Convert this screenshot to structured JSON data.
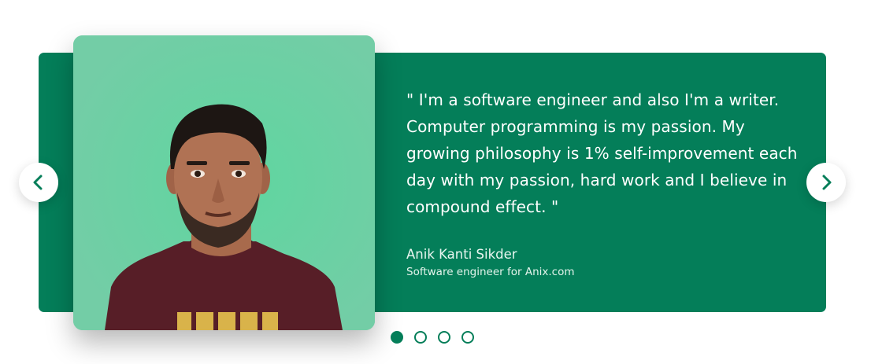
{
  "testimonial": {
    "quote": "\" I'm a software engineer and also I'm a writer. Computer programming is my passion. My growing philosophy is 1% self-improvement each day with my passion, hard work and I believe in compound effect. \"",
    "author": "Anik Kanti Sikder",
    "role": "Software engineer for Anix.com",
    "photo_icon": "person-portrait"
  },
  "navigation": {
    "prev_icon": "chevron-left-icon",
    "next_icon": "chevron-right-icon"
  },
  "pagination": {
    "total": 4,
    "active_index": 0
  },
  "colors": {
    "accent": "#047e59",
    "photo_background": "#6fcfa4",
    "text_on_accent": "#ffffff"
  }
}
